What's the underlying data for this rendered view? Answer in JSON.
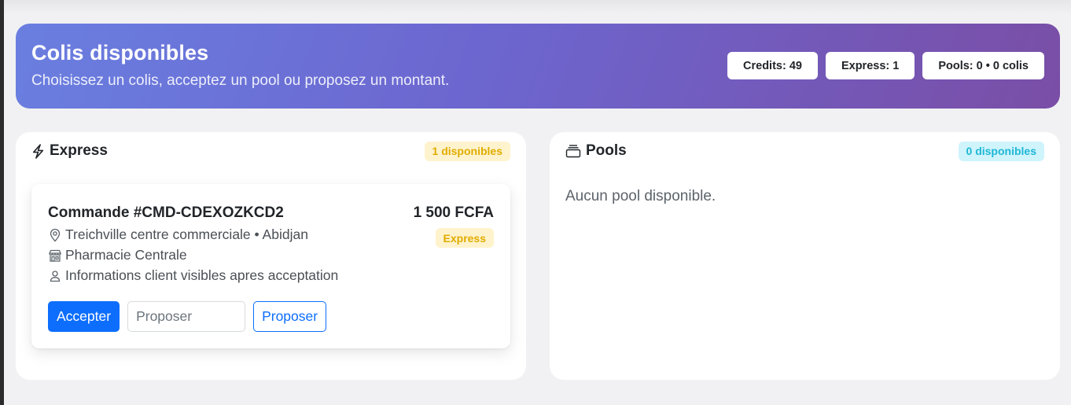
{
  "header": {
    "title": "Colis disponibles",
    "subtitle": "Choisissez un colis, acceptez un pool ou proposez un montant.",
    "badges": {
      "credits": "Credits: 49",
      "express": "Express: 1",
      "pools": "Pools: 0 • 0 colis"
    }
  },
  "express_panel": {
    "title": "Express",
    "count_badge": "1 disponibles",
    "orders": [
      {
        "title": "Commande #CMD-CDEXOZKCD2",
        "price": "1 500 FCFA",
        "type_badge": "Express",
        "location": "Treichville centre commerciale • Abidjan",
        "store": "Pharmacie Centrale",
        "client_note": "Informations client visibles apres acceptation",
        "accept_label": "Accepter",
        "propose_placeholder": "Proposer",
        "propose_label": "Proposer"
      }
    ]
  },
  "pools_panel": {
    "title": "Pools",
    "count_badge": "0 disponibles",
    "empty_text": "Aucun pool disponible."
  },
  "colors": {
    "gradient_start": "#6a7fe0",
    "gradient_end": "#7a4ea6",
    "primary": "#0d6efd",
    "warning_bg": "#fff3cd",
    "warning_text": "#e0ac00",
    "info_bg": "#cff4fc",
    "info_text": "#1fb7d6"
  },
  "icons": {
    "express": "lightning-icon",
    "pools": "stack-icon",
    "location": "map-pin-icon",
    "store": "shop-icon",
    "client": "person-icon"
  }
}
